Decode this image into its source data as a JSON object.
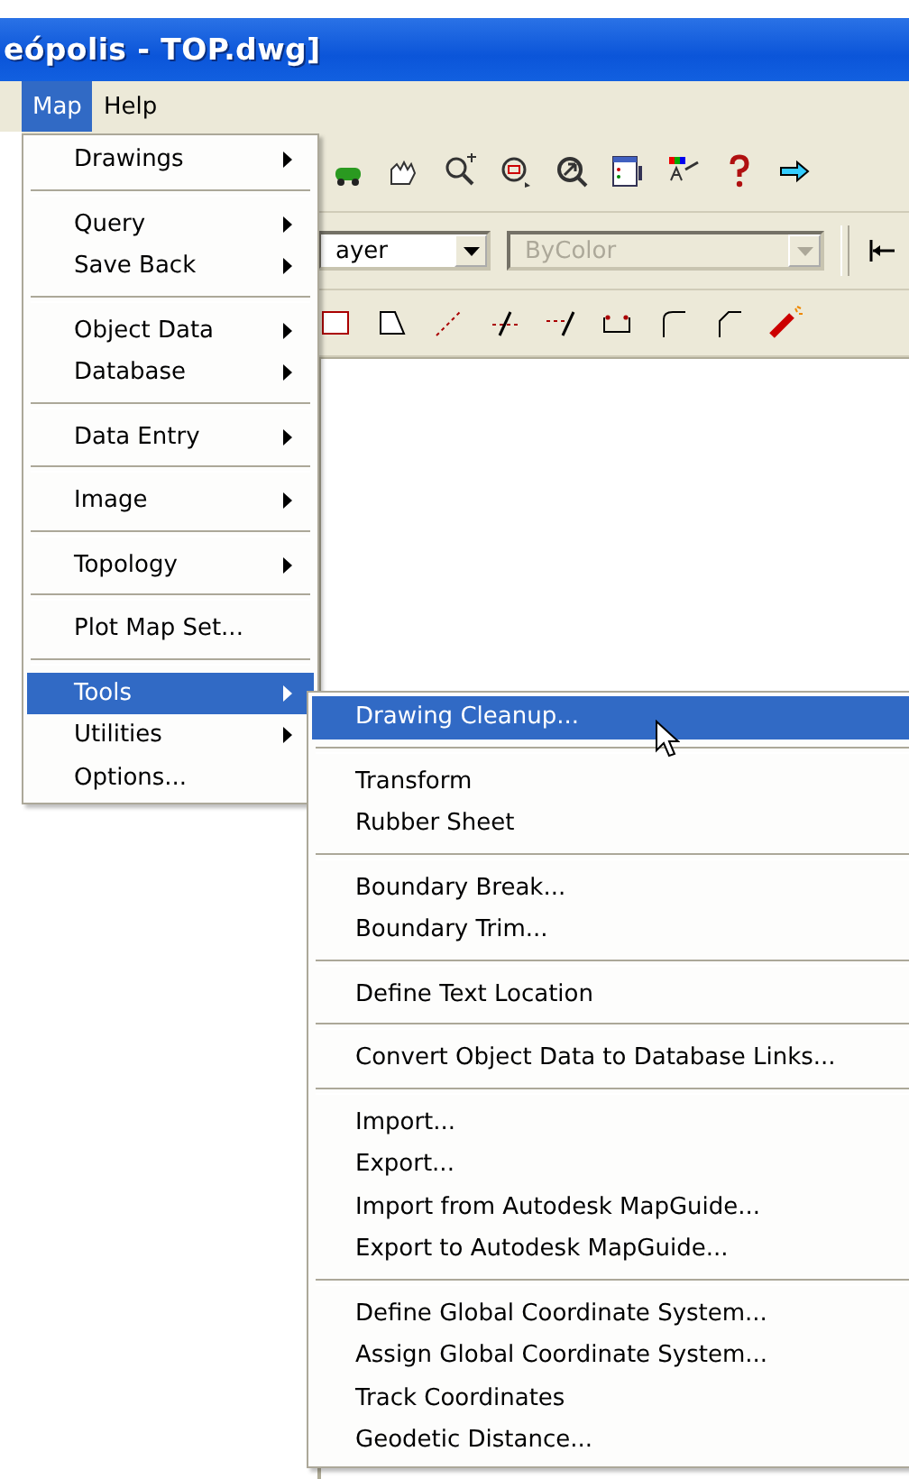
{
  "window": {
    "title": "eópolis - TOP.dwg]"
  },
  "menu_bar": [
    {
      "label": "Map",
      "selected": true
    },
    {
      "label": "Help",
      "selected": false
    }
  ],
  "toolbar": {
    "layer_combo": {
      "value": "ayer",
      "disabled": false
    },
    "color_combo": {
      "value": "ByColor",
      "disabled": true
    }
  },
  "menu": {
    "groups": [
      [
        {
          "label": "Drawings",
          "submenu": true,
          "selected": false
        }
      ],
      [
        {
          "label": "Query",
          "submenu": true,
          "selected": false
        },
        {
          "label": "Save Back",
          "submenu": true,
          "selected": false
        }
      ],
      [
        {
          "label": "Object Data",
          "submenu": true,
          "selected": false
        },
        {
          "label": "Database",
          "submenu": true,
          "selected": false
        }
      ],
      [
        {
          "label": "Data Entry",
          "submenu": true,
          "selected": false
        }
      ],
      [
        {
          "label": "Image",
          "submenu": true,
          "selected": false
        }
      ],
      [
        {
          "label": "Topology",
          "submenu": true,
          "selected": false
        }
      ],
      [
        {
          "label": "Plot Map Set...",
          "submenu": false,
          "selected": false
        }
      ],
      [
        {
          "label": "Tools",
          "submenu": true,
          "selected": true
        },
        {
          "label": "Utilities",
          "submenu": true,
          "selected": false
        },
        {
          "label": "Options...",
          "submenu": false,
          "selected": false
        }
      ]
    ]
  },
  "submenu": {
    "groups": [
      [
        {
          "label": "Drawing Cleanup...",
          "selected": true
        }
      ],
      [
        {
          "label": "Transform",
          "selected": false
        },
        {
          "label": "Rubber Sheet",
          "selected": false
        }
      ],
      [
        {
          "label": "Boundary Break...",
          "selected": false
        },
        {
          "label": "Boundary Trim...",
          "selected": false
        }
      ],
      [
        {
          "label": "Define Text Location",
          "selected": false
        }
      ],
      [
        {
          "label": "Convert Object Data to Database Links...",
          "selected": false
        }
      ],
      [
        {
          "label": "Import...",
          "selected": false
        },
        {
          "label": "Export...",
          "selected": false
        },
        {
          "label": "Import from Autodesk MapGuide...",
          "selected": false
        },
        {
          "label": "Export to Autodesk MapGuide...",
          "selected": false
        }
      ],
      [
        {
          "label": "Define Global Coordinate System...",
          "selected": false
        },
        {
          "label": "Assign Global Coordinate System...",
          "selected": false
        },
        {
          "label": "Track Coordinates",
          "selected": false
        },
        {
          "label": "Geodetic Distance...",
          "selected": false
        }
      ]
    ]
  }
}
